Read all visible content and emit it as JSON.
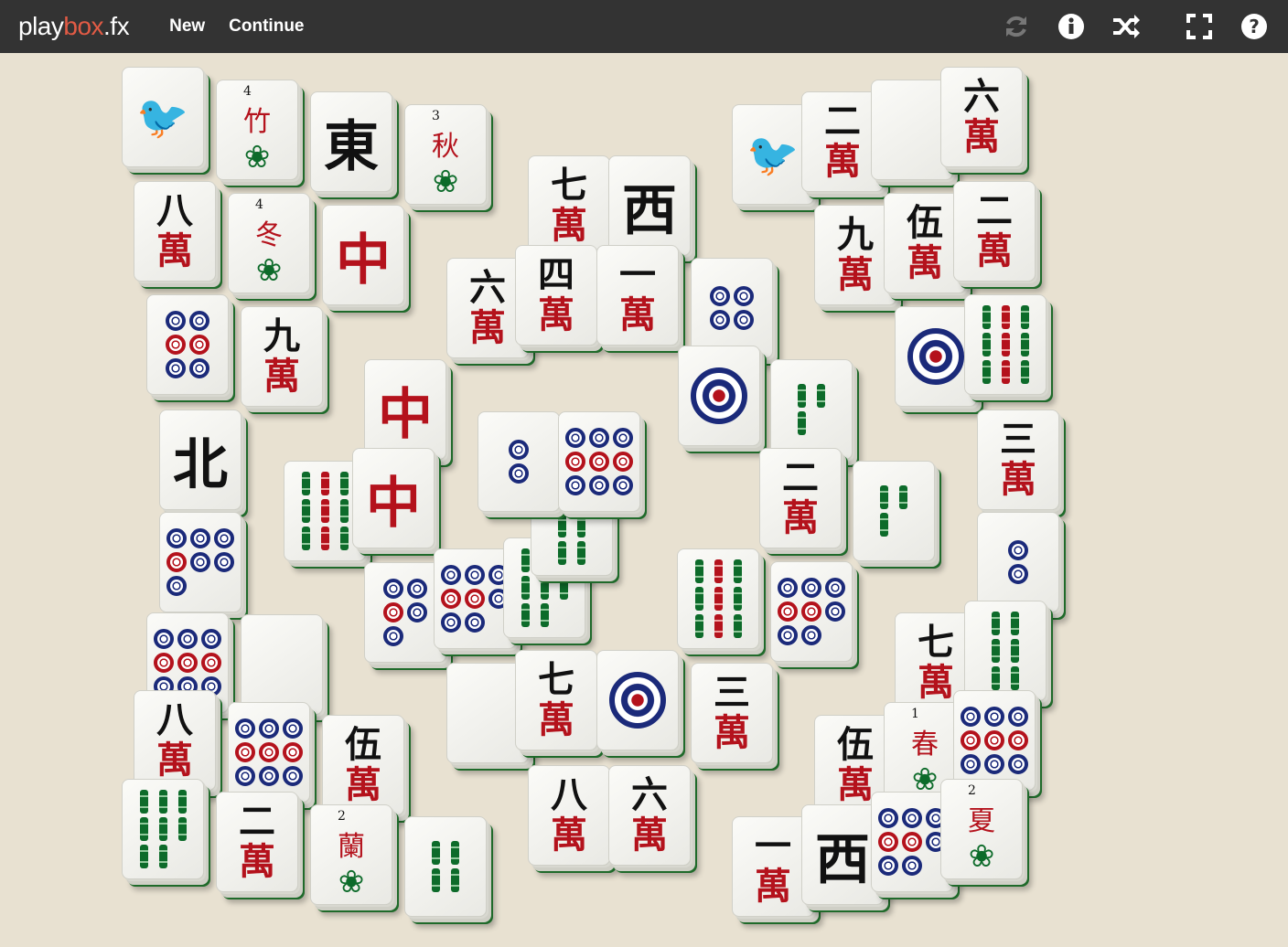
{
  "header": {
    "logo_play": "play",
    "logo_box": "box",
    "logo_fx": ".fx",
    "nav": [
      {
        "label": "New"
      },
      {
        "label": "Continue"
      }
    ],
    "icons": [
      "refresh-icon",
      "info-icon",
      "shuffle-icon",
      "fullscreen-icon",
      "help-icon"
    ]
  },
  "colors": {
    "header_bg": "#333333",
    "board_bg": "#e8e1d1",
    "logo_accent": "#e25b45",
    "tile_edge": "#1f6a2a",
    "dot_blue": "#1b2a7a",
    "char_red": "#b4121c",
    "bamboo_green": "#0d6b2a"
  },
  "tiles": [
    {
      "suit": "bamboo",
      "n": 1
    },
    {
      "suit": "flower",
      "char": "竹",
      "n": "4"
    },
    {
      "suit": "honor",
      "char": "東"
    },
    {
      "suit": "flower",
      "char": "秋",
      "n": "3"
    },
    {
      "suit": "char",
      "char": "八",
      "wan": "萬"
    },
    {
      "suit": "flower",
      "char": "冬",
      "n": "4"
    },
    {
      "suit": "honor",
      "char": "中",
      "red": true
    },
    {
      "suit": "dots",
      "n": 6
    },
    {
      "suit": "char",
      "char": "九",
      "wan": "萬"
    },
    {
      "suit": "honor",
      "char": "北"
    },
    {
      "suit": "dots",
      "n": 7
    },
    {
      "suit": "dots",
      "n": 9
    },
    {
      "suit": "blank"
    },
    {
      "suit": "char",
      "char": "八",
      "wan": "萬"
    },
    {
      "suit": "dots",
      "n": 9
    },
    {
      "suit": "char",
      "char": "伍",
      "wan": "萬"
    },
    {
      "suit": "bamboo",
      "n": 8
    },
    {
      "suit": "char",
      "char": "二",
      "wan": "萬"
    },
    {
      "suit": "flower",
      "char": "蘭",
      "n": "2"
    },
    {
      "suit": "bamboo",
      "n": 4
    },
    {
      "suit": "char",
      "char": "七",
      "wan": "萬"
    },
    {
      "suit": "honor",
      "char": "西"
    },
    {
      "suit": "char",
      "char": "六",
      "wan": "萬"
    },
    {
      "suit": "char",
      "char": "四",
      "wan": "萬"
    },
    {
      "suit": "char",
      "char": "一",
      "wan": "萬"
    },
    {
      "suit": "dots",
      "n": 4
    },
    {
      "suit": "honor",
      "char": "中",
      "red": true
    },
    {
      "suit": "dots",
      "n": 1
    },
    {
      "suit": "bamboo",
      "n": 3
    },
    {
      "suit": "bamboo",
      "n": 9
    },
    {
      "suit": "honor",
      "char": "中",
      "red": true
    },
    {
      "suit": "char",
      "char": "二",
      "wan": "萬"
    },
    {
      "suit": "bamboo",
      "n": 3
    },
    {
      "suit": "dots",
      "n": 5
    },
    {
      "suit": "dots",
      "n": 8
    },
    {
      "suit": "bamboo",
      "n": 8
    },
    {
      "suit": "bamboo",
      "n": 9
    },
    {
      "suit": "dots",
      "n": 8
    },
    {
      "suit": "blank"
    },
    {
      "suit": "char",
      "char": "七",
      "wan": "萬"
    },
    {
      "suit": "dots",
      "n": 1
    },
    {
      "suit": "char",
      "char": "三",
      "wan": "萬"
    },
    {
      "suit": "char",
      "char": "八",
      "wan": "萬"
    },
    {
      "suit": "char",
      "char": "六",
      "wan": "萬"
    },
    {
      "suit": "bamboo",
      "n": 6
    },
    {
      "suit": "dots",
      "n": 2
    },
    {
      "suit": "dots",
      "n": 9
    },
    {
      "suit": "bamboo",
      "n": 1
    },
    {
      "suit": "char",
      "char": "二",
      "wan": "萬"
    },
    {
      "suit": "blank"
    },
    {
      "suit": "char",
      "char": "六",
      "wan": "萬"
    },
    {
      "suit": "char",
      "char": "九",
      "wan": "萬"
    },
    {
      "suit": "char",
      "char": "伍",
      "wan": "萬"
    },
    {
      "suit": "char",
      "char": "二",
      "wan": "萬"
    },
    {
      "suit": "dots",
      "n": 1
    },
    {
      "suit": "bamboo",
      "n": 9
    },
    {
      "suit": "char",
      "char": "三",
      "wan": "萬"
    },
    {
      "suit": "dots",
      "n": 2
    },
    {
      "suit": "char",
      "char": "七",
      "wan": "萬"
    },
    {
      "suit": "bamboo",
      "n": 6
    },
    {
      "suit": "char",
      "char": "伍",
      "wan": "萬"
    },
    {
      "suit": "flower",
      "char": "春",
      "n": "1"
    },
    {
      "suit": "dots",
      "n": 9
    },
    {
      "suit": "char",
      "char": "一",
      "wan": "萬"
    },
    {
      "suit": "honor",
      "char": "西"
    },
    {
      "suit": "dots",
      "n": 8
    },
    {
      "suit": "flower",
      "char": "夏",
      "n": "2"
    }
  ]
}
